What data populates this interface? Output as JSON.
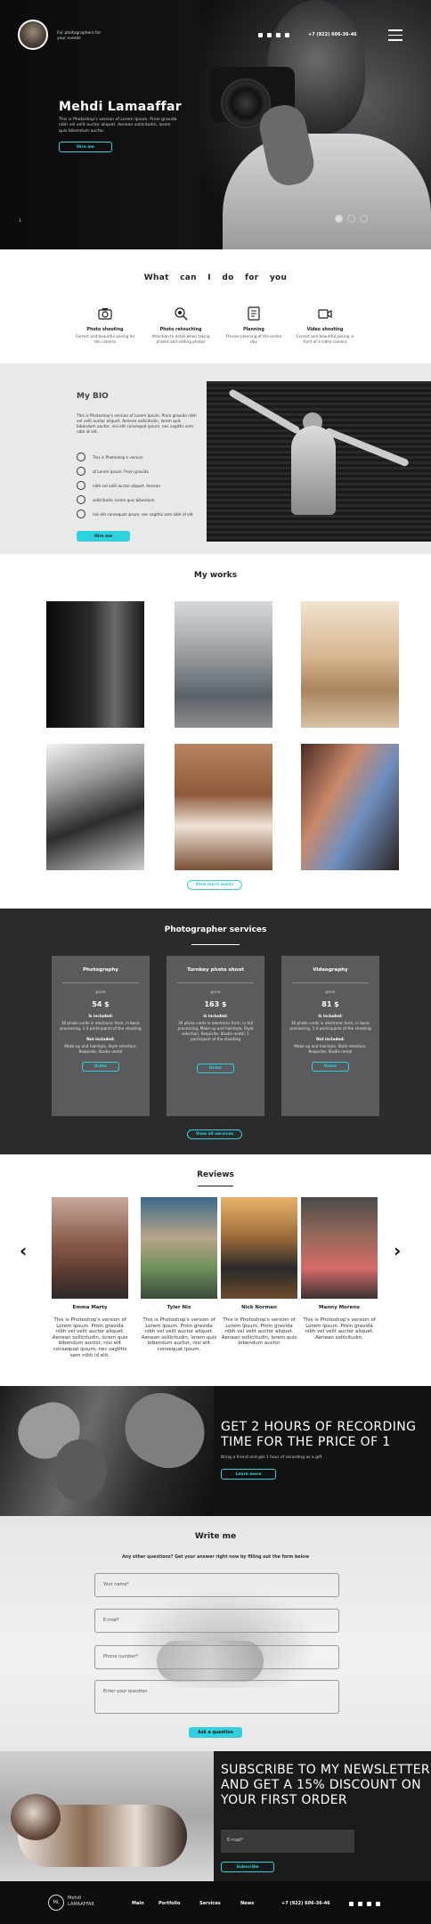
{
  "header": {
    "tagline": "For photographers for your events",
    "phone": "+7 (922) 606-36-46",
    "social": [
      "vk-icon",
      "twitter-icon",
      "instagram-icon",
      "youtube-icon"
    ]
  },
  "hero": {
    "title": "Mehdi Lamaaffar",
    "description": "This is Photoshop's version of Lorem Ipsum. Proin gravida nibh vel velit auctor aliquet. Aenean sollicitudin, lorem quis bibendum auctor.",
    "button": "Hire me"
  },
  "services_intro": {
    "title": "What can I do for you",
    "items": [
      {
        "icon": "camera-icon",
        "name": "Photo shooting",
        "desc": "Correct and beautiful posing for the camera"
      },
      {
        "icon": "retouch-icon",
        "name": "Photo retouching",
        "desc": "Attention to detail when taking photos and editing photos"
      },
      {
        "icon": "planning-icon",
        "name": "Planning",
        "desc": "Precise planning of the online day"
      },
      {
        "icon": "video-camera-icon",
        "name": "Video shooting",
        "desc": "Correct and beautiful posing in front of a video camera"
      }
    ]
  },
  "bio": {
    "title": "My BIO",
    "text": "This is Photoshop's version of Lorem Ipsum. Proin gravida nibh vel velit auctor aliquet. Aenean sollicitudin, lorem quis bibendum auctor, nisi elit consequat ipsum, nec sagittis sem nibh id elit.",
    "list": [
      "This is Photoshop's version",
      "of Lorem Ipsum. Proin gravida",
      "nibh vel velit auctor aliquet. Aenean",
      "sollicitudin, lorem quis bibendum",
      "nisi elit consequat ipsum, nec sagittis sem nibh id elit"
    ],
    "button": "Hire me"
  },
  "works": {
    "title": "My works",
    "button": "View more works"
  },
  "pricing": {
    "title": "Photographer services",
    "cards": [
      {
        "name": "Photography",
        "price_label": "price",
        "price": "54 $",
        "included_label": "Is included:",
        "included": "30 photo cards in electronic form, in basic processing, 1-3 participants of the shooting",
        "not_label": "Not included:",
        "not_included": "Make-up and hairstyle, Style selection, Requisite, Studio rental",
        "button": "Order"
      },
      {
        "name": "Turnkey photo shoot",
        "price_label": "price",
        "price": "163 $",
        "included_label": "Is included:",
        "included": "30 photo cards in electronic form, in full processing, Make-up and hairstyle, Style selection, Requisite, Studio rental, 1 participant of the shooting",
        "not_label": "",
        "not_included": "",
        "button": "Order"
      },
      {
        "name": "Videography",
        "price_label": "price",
        "price": "81 $",
        "included_label": "Is included:",
        "included": "30 photo cards in electronic form, in basic processing, 1-3 participants of the shooting",
        "not_label": "Not included:",
        "not_included": "Make-up and hairstyle, Style selection, Requisite, Studio rental",
        "button": "Order"
      }
    ],
    "button": "View all services"
  },
  "reviews": {
    "title": "Reviews",
    "items": [
      {
        "name": "Emma Marty",
        "text": "This is Photoshop's version of Lorem Ipsum. Proin gravida nibh vel velit auctor aliquet. Aenean sollicitudin, lorem quis bibendum auctor, nisi elit consequat ipsum, nec sagittis sem nibh id elit."
      },
      {
        "name": "Tyler Nix",
        "text": "This is Photoshop's version of Lorem Ipsum. Proin gravida nibh vel velit auctor aliquet. Aenean sollicitudin, lorem quis bibendum auctor, nisi elit consequat ipsum."
      },
      {
        "name": "Nick Norman",
        "text": "This is Photoshop's version of Lorem Ipsum. Proin gravida nibh vel velit auctor aliquet. Aenean sollicitudin, lorem quis bibendum auctor"
      },
      {
        "name": "Manny Moreno",
        "text": "This is Photoshop's version of Lorem Ipsum. Proin gravida nibh vel velit auctor aliquet. Aenean sollicitudin."
      }
    ]
  },
  "promo": {
    "title": "GET 2 HOURS OF RECORDING TIME FOR THE PRICE OF 1",
    "sub": "Bring a friend and get 1 hour of recording as a gift",
    "button": "Learn more"
  },
  "contact": {
    "title": "Write me",
    "sub": "Any other questions? Get your answer right now by filling out the form below",
    "fields": [
      "Your name*",
      "E-mail*",
      "Phone number*",
      "Enter your question"
    ],
    "button": "Ask a question"
  },
  "subscribe": {
    "title": "SUBSCRIBE TO MY NEWSLETTER AND GET A 15% DISCOUNT ON YOUR FIRST ORDER",
    "placeholder": "E-mail*",
    "button": "Subscribe"
  },
  "footer": {
    "logo": "ML",
    "brand_first": "Mehdi",
    "brand_last": "LAMAAFFAR",
    "nav": [
      "Main",
      "Portfolio",
      "Services",
      "News"
    ],
    "phone": "+7 (922) 606-36-46"
  },
  "colors": {
    "accent": "#2fd1df",
    "dark": "#2b2b2d",
    "card": "#5b5b5d"
  }
}
